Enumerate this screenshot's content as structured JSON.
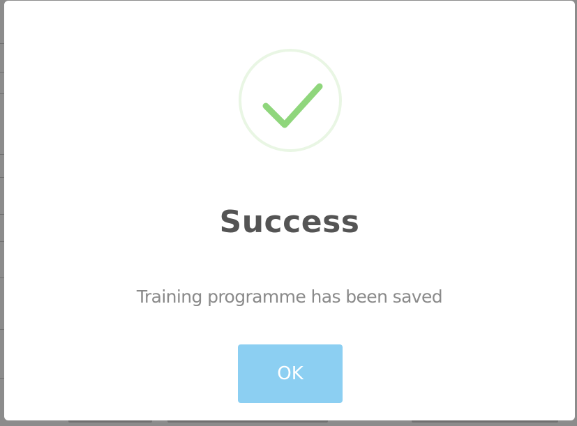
{
  "dialog": {
    "title": "Success",
    "message": "Training programme has been saved",
    "ok_label": "OK",
    "icon": "checkmark-success-icon"
  },
  "colors": {
    "check_stroke": "#8fd67c",
    "ring_stroke": "#e9f6e4",
    "button_background": "#8ccff2",
    "title_text": "#545454",
    "message_text": "#8a8a8a"
  }
}
